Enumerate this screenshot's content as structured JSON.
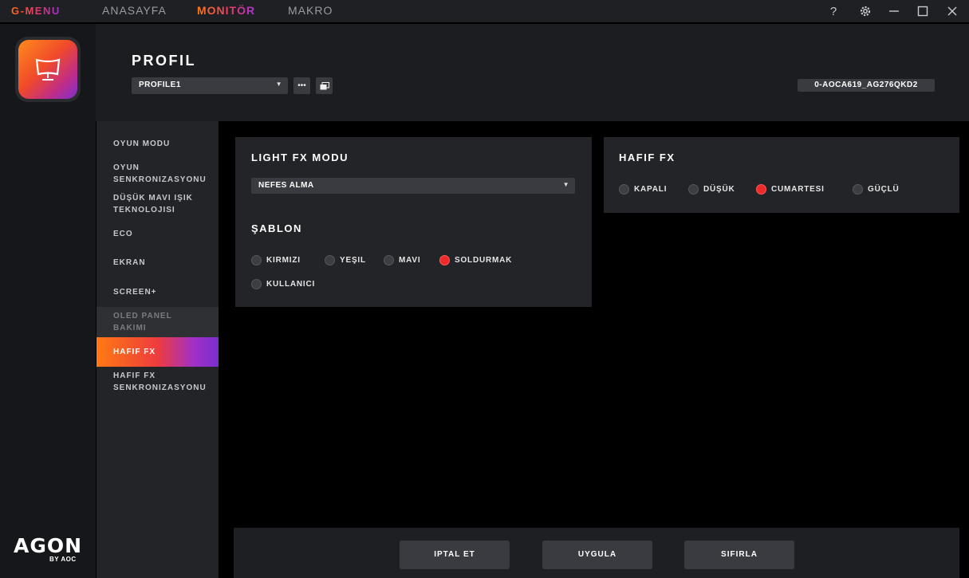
{
  "topbar": {
    "brand": "G-MENU",
    "tabs": [
      {
        "label": "ANASAYFA"
      },
      {
        "label": "MONITÖR"
      },
      {
        "label": "MAKRO"
      }
    ],
    "controls": {
      "help": "?",
      "settings_icon": "gear-icon",
      "minimize_icon": "minimize-icon",
      "maximize_icon": "maximize-icon",
      "close_icon": "close-icon"
    }
  },
  "rail": {
    "logo_main": "AGON",
    "logo_sub": "BY AOC"
  },
  "header": {
    "title": "PROFIL",
    "profile_selected": "PROFILE1",
    "model": "0-AOCA619_AG276QKD2"
  },
  "sidemenu": {
    "items": [
      {
        "label": "OYUN MODU"
      },
      {
        "label_line1": "OYUN",
        "label_line2": "SENKRONIZASYONU"
      },
      {
        "label_line1": "DÜŞÜK MAVI IŞIK",
        "label_line2": "TEKNOLOJISI"
      },
      {
        "label": "ECO"
      },
      {
        "label": "EKRAN"
      },
      {
        "label": "SCREEN+"
      },
      {
        "label_line1": "OLED PANEL",
        "label_line2": "BAKIMI"
      },
      {
        "label": "HAFIF FX"
      },
      {
        "label_line1": "HAFIF FX",
        "label_line2": "SENKRONIZASYONU"
      }
    ]
  },
  "lightfx": {
    "title": "LIGHT FX MODU",
    "mode_selected": "NEFES ALMA",
    "template_title": "ŞABLON",
    "template_options": [
      {
        "label": "KIRMIZI",
        "selected": false
      },
      {
        "label": "YEŞIL",
        "selected": false
      },
      {
        "label": "MAVI",
        "selected": false
      },
      {
        "label": "SOLDURMAK",
        "selected": true
      },
      {
        "label": "KULLANICI",
        "selected": false
      }
    ]
  },
  "hafiffx": {
    "title": "HAFIF FX",
    "options": [
      {
        "label": "KAPALI",
        "selected": false
      },
      {
        "label": "DÜŞÜK",
        "selected": false
      },
      {
        "label": "CUMARTESI",
        "selected": true
      },
      {
        "label": "GÜÇLÜ",
        "selected": false
      }
    ]
  },
  "footer": {
    "cancel": "IPTAL ET",
    "apply": "UYGULA",
    "reset": "SIFIRLA"
  },
  "colors": {
    "accent_orange": "#ff7a12",
    "accent_purple": "#7c2dd0",
    "selected_radio": "#ee2a2a"
  }
}
